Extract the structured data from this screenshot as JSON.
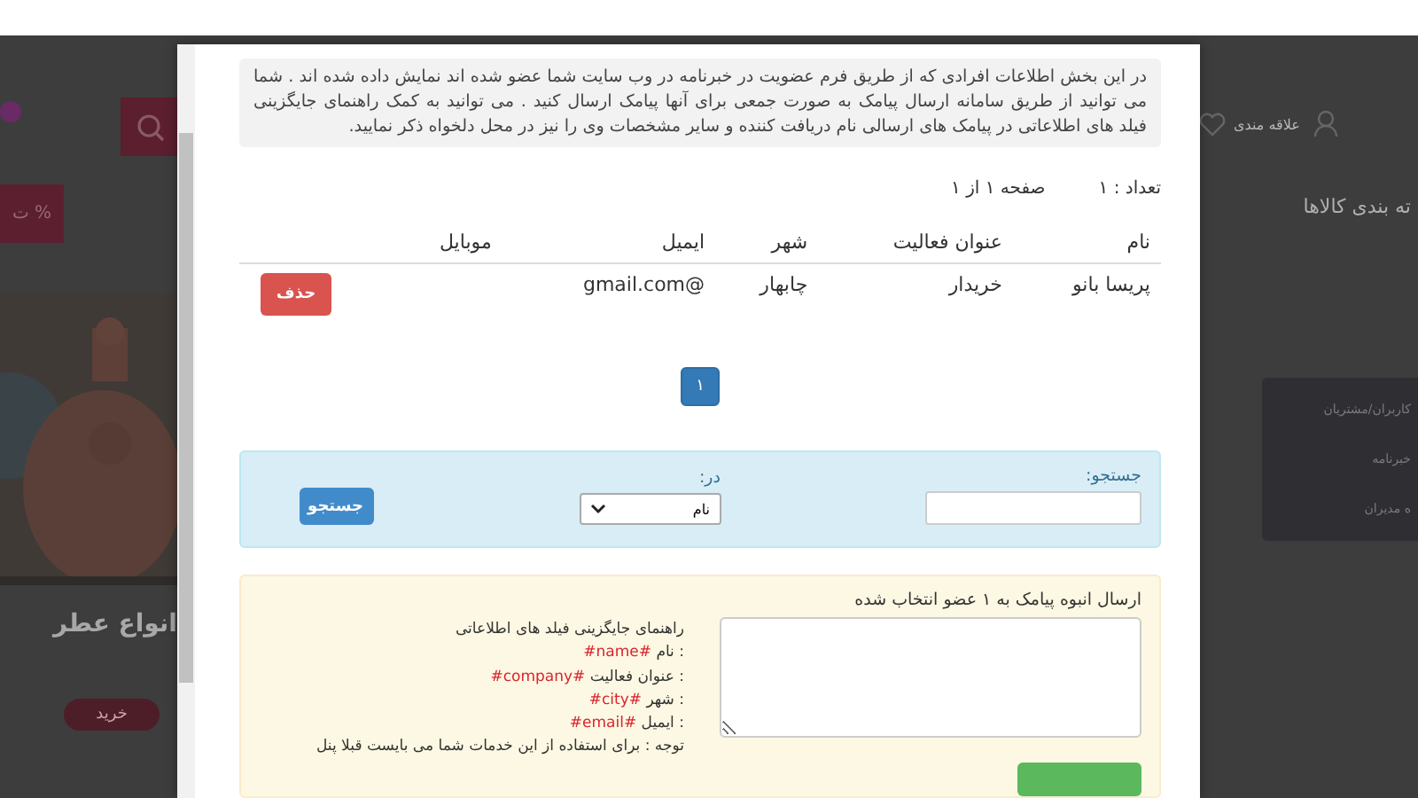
{
  "background": {
    "category_heading": "ته بندی کالاها",
    "wishlist": "علاقه مندی",
    "menu_items": [
      "کاربران/مشتریان",
      "خبرنامه",
      "ه مدیران"
    ],
    "discount": "% ت",
    "banner_title": "انواع عطر",
    "banner_button": "خرید"
  },
  "dialog": {
    "intro": "در این بخش اطلاعات افرادی که از طریق فرم عضویت در خبرنامه در وب سایت شما عضو شده اند نمایش داده شده اند . شما می توانید  از طریق سامانه ارسال پیامک به صورت جمعی برای آنها پیامک ارسال کنید . می توانید به کمک راهنمای جایگزینی فیلد های اطلاعاتی در پیامک های ارسالی نام دریافت کننده و سایر مشخصات وی را نیز در محل دلخواه ذکر نمایید.",
    "count": "تعداد : ۱",
    "page_info": "صفحه ۱ از ۱",
    "table": {
      "columns": [
        "نام",
        "عنوان فعالیت",
        "شهر",
        "ایمیل",
        "موبایل"
      ],
      "rows": [
        {
          "cells": [
            "پریسا بانو",
            "خریدار",
            "چابهار",
            "@gmail.com"
          ],
          "action": "حذف"
        }
      ]
    },
    "pagination": [
      {
        "label": "۱",
        "selected": true
      }
    ],
    "search": {
      "label": "جستجو:",
      "in_label": "در:",
      "in_value": "نام",
      "button": "جستجو"
    },
    "sms": {
      "label": "ارسال انبوه پیامک به ۱ عضو انتخاب شده",
      "guide_title": "راهنمای جایگزینی فیلد های اطلاعاتی",
      "fields": [
        {
          "label": ": نام",
          "token": "#name#"
        },
        {
          "label": ": عنوان فعالیت",
          "token": "#company#"
        },
        {
          "label": ": شهر",
          "token": "#city#"
        },
        {
          "label": ": ایمیل",
          "token": "#email#"
        }
      ],
      "note": "توجه : برای استفاده از این خدمات شما می بایست قبلا پنل"
    }
  }
}
